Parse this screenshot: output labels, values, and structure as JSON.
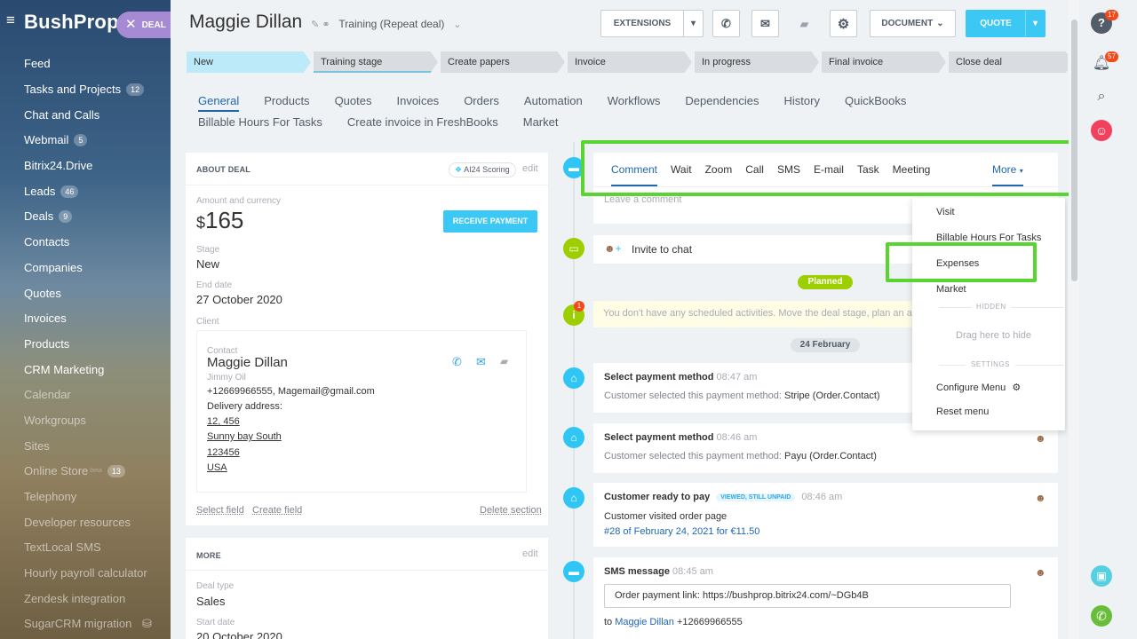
{
  "sidebar": {
    "logo": "BushProp",
    "deal_label": "DEAL",
    "items": [
      {
        "label": "Feed",
        "count": ""
      },
      {
        "label": "Tasks and Projects",
        "count": "12"
      },
      {
        "label": "Chat and Calls",
        "count": ""
      },
      {
        "label": "Webmail",
        "count": "5"
      },
      {
        "label": "Bitrix24.Drive",
        "count": ""
      },
      {
        "label": "Leads",
        "count": "46"
      },
      {
        "label": "Deals",
        "count": "9"
      },
      {
        "label": "Contacts",
        "count": ""
      },
      {
        "label": "Companies",
        "count": ""
      },
      {
        "label": "Quotes",
        "count": ""
      },
      {
        "label": "Invoices",
        "count": ""
      },
      {
        "label": "Products",
        "count": ""
      },
      {
        "label": "CRM Marketing",
        "count": ""
      },
      {
        "label": "Calendar",
        "count": ""
      },
      {
        "label": "Workgroups",
        "count": ""
      },
      {
        "label": "Sites",
        "count": ""
      },
      {
        "label": "Online Store",
        "count": "13",
        "sup": "beta"
      },
      {
        "label": "Telephony",
        "count": ""
      },
      {
        "label": "Developer resources",
        "count": ""
      },
      {
        "label": "TextLocal SMS",
        "count": ""
      },
      {
        "label": "Hourly payroll calculator",
        "count": ""
      },
      {
        "label": "Zendesk integration",
        "count": ""
      },
      {
        "label": "SugarCRM migration",
        "count": ""
      }
    ]
  },
  "header": {
    "title": "Maggie  Dillan",
    "subtitle": "Training (Repeat deal)",
    "extensions": "EXTENSIONS",
    "document": "DOCUMENT",
    "quote": "QUOTE"
  },
  "stages": [
    "New",
    "Training stage",
    "Create papers",
    "Invoice",
    "In progress",
    "Final invoice",
    "Close deal"
  ],
  "tabs": [
    "General",
    "Products",
    "Quotes",
    "Invoices",
    "Orders",
    "Automation",
    "Workflows",
    "Dependencies",
    "History",
    "QuickBooks",
    "Billable Hours For Tasks",
    "Create invoice in FreshBooks",
    "Market"
  ],
  "about": {
    "header": "ABOUT DEAL",
    "scoring": "AI24 Scoring",
    "edit": "edit",
    "amount_label": "Amount and currency",
    "currency": "$",
    "amount": "165",
    "receive_payment": "RECEIVE PAYMENT",
    "stage_label": "Stage",
    "stage": "New",
    "end_label": "End date",
    "end_date": "27 October 2020",
    "client_label": "Client",
    "contact_label": "Contact",
    "contact_name": "Maggie Dillan",
    "company": "Jimmy Oil",
    "phone_email": "+12669966555, Magemail@gmail.com",
    "delivery_label": "Delivery address:",
    "addr1": "12, 456",
    "addr2": "Sunny bay South",
    "addr3": "123456",
    "addr4": "USA",
    "select_field": "Select field",
    "create_field": "Create field",
    "delete_section": "Delete section"
  },
  "more": {
    "header": "MORE",
    "edit": "edit",
    "type_label": "Deal type",
    "type": "Sales",
    "start_label": "Start date",
    "start": "20 October 2020"
  },
  "activity": {
    "tabs": [
      "Comment",
      "Wait",
      "Zoom",
      "Call",
      "SMS",
      "E-mail",
      "Task",
      "Meeting"
    ],
    "more": "More",
    "placeholder": "Leave a comment",
    "invite": "Invite to chat",
    "planned": "Planned",
    "no_activities": "You don't have any scheduled activities. Move the deal stage, plan an activity",
    "date_sep": "24 February"
  },
  "feed": [
    {
      "title": "Select payment method",
      "time": "08:47 am",
      "body": "Customer selected this payment method:",
      "value": "Stripe (Order.Contact)"
    },
    {
      "title": "Select payment method",
      "time": "08:46 am",
      "body": "Customer selected this payment method:",
      "value": "Payu (Order.Contact)"
    },
    {
      "title": "Customer ready to pay",
      "badge": "VIEWED, STILL UNPAID",
      "time": "08:46 am",
      "body": "Customer visited order page",
      "value": "#28 of February 24, 2021 for €11.50"
    },
    {
      "title": "SMS message",
      "time": "08:45 am",
      "body": "Order payment link: https://bushprop.bitrix24.com/~DGb4B",
      "to_label": "to",
      "to_name": "Maggie Dillan",
      "to_phone": "+12669966555"
    }
  ],
  "dropdown": {
    "items": [
      "Visit",
      "Billable Hours For Tasks",
      "Expenses",
      "Market"
    ],
    "hidden": "HIDDEN",
    "drag": "Drag here to hide",
    "settings": "SETTINGS",
    "configure": "Configure Menu",
    "reset": "Reset menu"
  },
  "right": {
    "help_count": "17",
    "notif_count": "57"
  },
  "colors": {
    "accent": "#3bc8f5",
    "highlight": "#5ad431",
    "link": "#2067b0"
  }
}
